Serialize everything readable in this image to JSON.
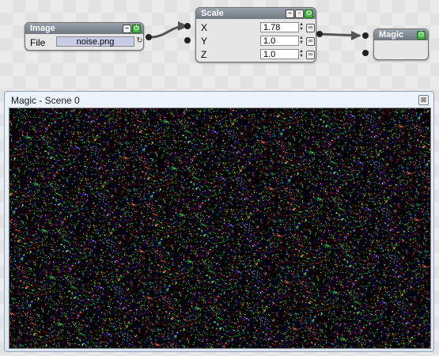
{
  "image_node": {
    "title": "Image",
    "file_label": "File",
    "file_value": "noise.png",
    "reload_icon": "reload-icon"
  },
  "scale_node": {
    "title": "Scale",
    "rows": [
      {
        "label": "X",
        "value": "1.78"
      },
      {
        "label": "Y",
        "value": "1.0"
      },
      {
        "label": "Z",
        "value": "1.0"
      }
    ]
  },
  "magic_node": {
    "title": "Magic"
  },
  "viewer": {
    "title": "Magic - Scene 0",
    "close_glyph": "⊠"
  },
  "icons": {
    "minimize": "minimize-icon",
    "maximize": "maximize-icon",
    "power": "power-icon",
    "spin": "spin-arrows-icon",
    "link": "link-icon"
  },
  "colors": {
    "node_header": "#7e8791",
    "file_field": "#c9cde7",
    "enable_button": "#3fb83f"
  }
}
